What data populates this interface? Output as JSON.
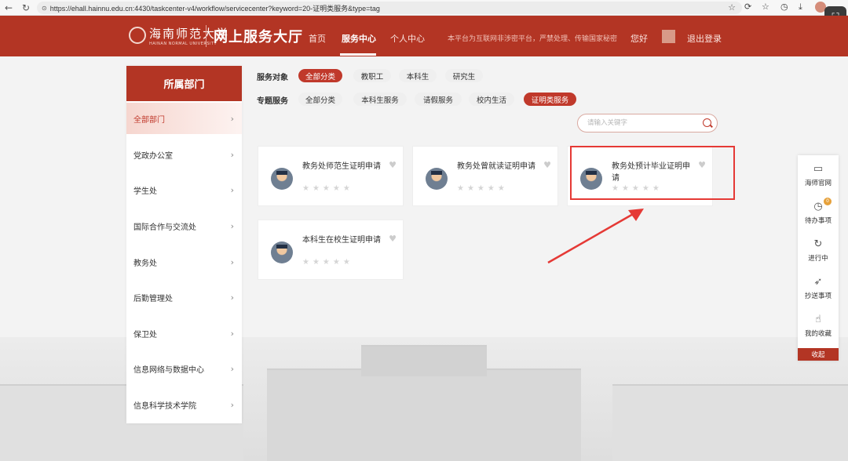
{
  "browser": {
    "url": "https://ehall.hainnu.edu.cn:4430/taskcenter-v4/workflow/servicecenter?keyword=20-证明类服务&type=tag"
  },
  "header": {
    "logo_text": "海南师范大学",
    "logo_en": "HAINAN NORMAL UNIVERSITY",
    "site_title": "网上服务大厅",
    "nav": [
      {
        "label": "首页"
      },
      {
        "label": "服务中心"
      },
      {
        "label": "个人中心"
      }
    ],
    "slogan": "本平台为互联网非涉密平台，严禁处理、传输国家秘密",
    "greeting": "您好",
    "logout": "退出登录",
    "accent_color": "#b33524"
  },
  "sidebar": {
    "title": "所属部门",
    "items": [
      {
        "label": "全部部门"
      },
      {
        "label": "党政办公室"
      },
      {
        "label": "学生处"
      },
      {
        "label": "国际合作与交流处"
      },
      {
        "label": "教务处"
      },
      {
        "label": "后勤管理处"
      },
      {
        "label": "保卫处"
      },
      {
        "label": "信息网络与数据中心"
      },
      {
        "label": "信息科学技术学院"
      }
    ]
  },
  "filters": {
    "audience_label": "服务对象",
    "audience": [
      {
        "label": "全部分类"
      },
      {
        "label": "教职工"
      },
      {
        "label": "本科生"
      },
      {
        "label": "研究生"
      }
    ],
    "topic_label": "专题服务",
    "topics": [
      {
        "label": "全部分类"
      },
      {
        "label": "本科生服务"
      },
      {
        "label": "请假服务"
      },
      {
        "label": "校内生活"
      },
      {
        "label": "证明类服务"
      }
    ]
  },
  "search": {
    "placeholder": "请输入关键字"
  },
  "services": [
    {
      "title": "教务处师范生证明申请"
    },
    {
      "title": "教务处曾就读证明申请"
    },
    {
      "title": "教务处预计毕业证明申请"
    },
    {
      "title": "本科生在校生证明申请"
    }
  ],
  "side_panel": {
    "items": [
      {
        "label": "海师官网",
        "icon": "monitor-icon"
      },
      {
        "label": "待办事项",
        "icon": "clock-icon",
        "badge": "0"
      },
      {
        "label": "进行中",
        "icon": "refresh-icon"
      },
      {
        "label": "抄送事项",
        "icon": "rocket-icon"
      },
      {
        "label": "我的收藏",
        "icon": "thumbs-up-icon"
      }
    ],
    "collapse": "收起"
  }
}
